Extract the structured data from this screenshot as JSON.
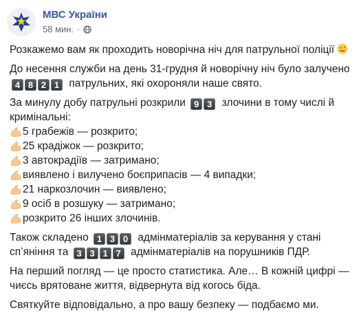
{
  "post": {
    "page_name": "МВС України",
    "time": "58 мин.",
    "dot": "·",
    "intro": "Розкажемо вам як проходить новорічна ніч для патрульної поліції",
    "p2_before": "До несення служби на день 31-грудня й новорічну ніч було залучено",
    "p2_digits": [
      "4",
      "8",
      "2",
      "1"
    ],
    "p2_after": "патрульних, які охороняли наше свято.",
    "p3_before": "За минулу добу патрульні розкрили",
    "p3_digits": [
      "9",
      "3"
    ],
    "p3_after": "злочини в тому числі й кримінальні:",
    "list": [
      "5 грабежів — розкрито;",
      "25 крадіжок — розкрито;",
      "3 автокрадіїв — затримано;",
      "виявлено і вилучено боєприпасів — 4 випадки;",
      "21 наркозлочин — виявлено;",
      "9 осіб в розшуку — затримано;",
      "розкрито 26 інших злочинів."
    ],
    "p4_before": "Також складено",
    "p4_digits1": [
      "1",
      "3",
      "0"
    ],
    "p4_middle": "адмінматеріалів за керування у стані сп’яніння та",
    "p4_digits2": [
      "3",
      "3",
      "1",
      "7"
    ],
    "p4_after": "адмінматеріалів на порушників ПДР.",
    "p5": "На перший погляд — це просто статистика. Але… В кожній цифрі — чиєсь врятоване життя, відвернута від когось біда.",
    "p6": "Святкуйте відповідально, а про вашу безпеку — подбаємо ми."
  },
  "colors": {
    "link": "#385898",
    "text": "#1c1e21",
    "meta": "#616770",
    "key": "#3c3f42",
    "emoji": "#f5c98f"
  },
  "icons": {
    "avatar": "police-emblem-icon",
    "privacy": "globe-icon",
    "smile": "smile-emoji-icon",
    "list": "flexed-biceps-icon"
  }
}
